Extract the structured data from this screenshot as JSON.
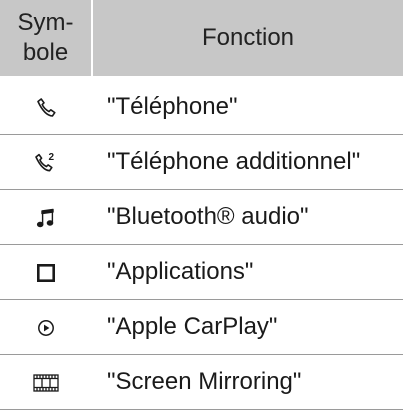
{
  "header": {
    "symbol_line1": "Sym-",
    "symbol_line2": "bole",
    "function": "Fonction"
  },
  "rows": [
    {
      "icon": "phone-handset-icon",
      "label": "\"Téléphone\""
    },
    {
      "icon": "phone-handset-secondary-icon",
      "label": "\"Téléphone additionnel\""
    },
    {
      "icon": "music-note-icon",
      "label": "\"Bluetooth® audio\""
    },
    {
      "icon": "square-icon",
      "label": "\"Applications\""
    },
    {
      "icon": "play-circle-icon",
      "label": "\"Apple CarPlay\""
    },
    {
      "icon": "film-strip-icon",
      "label": "\"Screen Mirroring\""
    }
  ],
  "colors": {
    "header_bg": "#c7c7c7",
    "row_divider": "#9a9a9a",
    "icon_stroke": "#1a1a1a"
  }
}
